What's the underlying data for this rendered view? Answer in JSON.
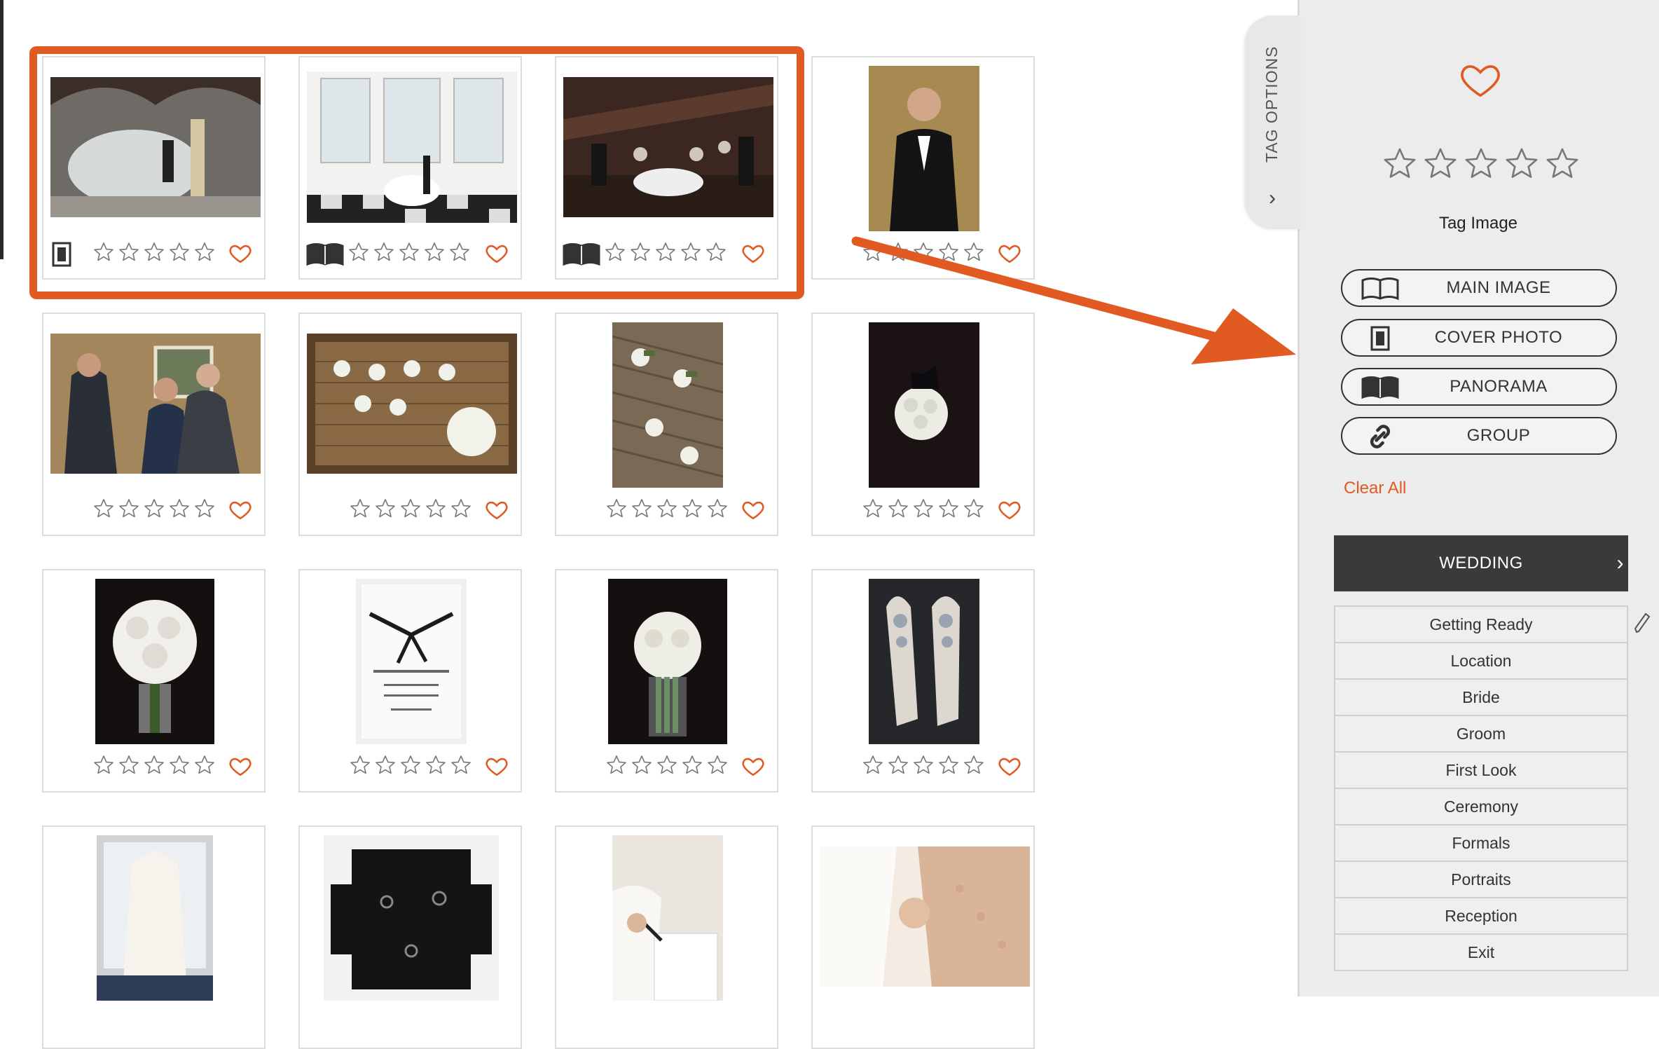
{
  "panel": {
    "tab_label": "TAG OPTIONS",
    "tab_chevron": "›",
    "tag_image_label": "Tag Image",
    "buttons": [
      {
        "label": "MAIN IMAGE",
        "icon": "open-book-outline-icon"
      },
      {
        "label": "COVER PHOTO",
        "icon": "cover-page-icon"
      },
      {
        "label": "PANORAMA",
        "icon": "open-book-filled-icon"
      },
      {
        "label": "GROUP",
        "icon": "link-chain-icon"
      }
    ],
    "clear_all": "Clear All",
    "section_title": "WEDDING",
    "section_chevron": "›",
    "categories": [
      "Getting Ready",
      "Location",
      "Bride",
      "Groom",
      "First Look",
      "Ceremony",
      "Formals",
      "Portraits",
      "Reception",
      "Exit"
    ]
  },
  "colors": {
    "accent": "#e05a22",
    "star": "#777777",
    "dark_header": "#3a3a3a"
  },
  "photos": [
    {
      "subject": "bride and groom with veil under arches",
      "tag": "cover-photo"
    },
    {
      "subject": "couple in bright window room",
      "tag": "panorama"
    },
    {
      "subject": "wedding party on staircase",
      "tag": "panorama"
    },
    {
      "subject": "groom portrait",
      "tag": "none"
    },
    {
      "subject": "groom with parents",
      "tag": "none"
    },
    {
      "subject": "boutonnieres in basket",
      "tag": "none"
    },
    {
      "subject": "boutonnieres on wicker",
      "tag": "none"
    },
    {
      "subject": "white rose boutonniere",
      "tag": "none"
    },
    {
      "subject": "bridal bouquet in vase",
      "tag": "none"
    },
    {
      "subject": "wedding invitation card",
      "tag": "none"
    },
    {
      "subject": "bouquet in glass vase",
      "tag": "none"
    },
    {
      "subject": "jeweled bridal shoes",
      "tag": "none"
    },
    {
      "subject": "wedding dress hanging in window",
      "tag": "none"
    },
    {
      "subject": "rings on black fabric",
      "tag": "none"
    },
    {
      "subject": "writing notes",
      "tag": "none"
    },
    {
      "subject": "bride getting ready",
      "tag": "none"
    }
  ],
  "ratings": {
    "stars_per_image": 5,
    "filled": 0
  }
}
